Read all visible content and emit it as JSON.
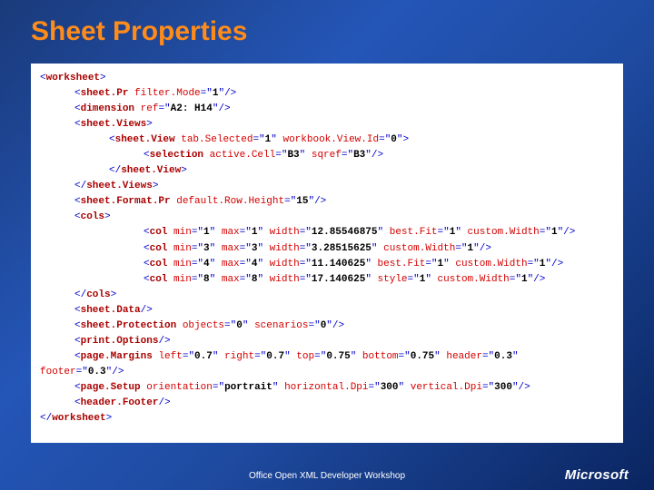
{
  "title": "Sheet Properties",
  "footer": "Office Open XML Developer Workshop",
  "logo": "Microsoft",
  "code": [
    {
      "indent": 0,
      "parts": [
        [
          "p",
          "<"
        ],
        [
          "t",
          "worksheet"
        ],
        [
          "p",
          ">"
        ]
      ]
    },
    {
      "indent": 1,
      "parts": [
        [
          "p",
          "<"
        ],
        [
          "t",
          "sheet.Pr "
        ],
        [
          "a",
          "filter.Mode"
        ],
        [
          "p",
          "=\""
        ],
        [
          "v",
          "1"
        ],
        [
          "p",
          "\"/>"
        ]
      ]
    },
    {
      "indent": 1,
      "parts": [
        [
          "p",
          "<"
        ],
        [
          "t",
          "dimension "
        ],
        [
          "a",
          "ref"
        ],
        [
          "p",
          "=\""
        ],
        [
          "v",
          "A2: H14"
        ],
        [
          "p",
          "\"/>"
        ]
      ]
    },
    {
      "indent": 1,
      "parts": [
        [
          "p",
          "<"
        ],
        [
          "t",
          "sheet.Views"
        ],
        [
          "p",
          ">"
        ]
      ]
    },
    {
      "indent": 2,
      "parts": [
        [
          "p",
          "<"
        ],
        [
          "t",
          "sheet.View "
        ],
        [
          "a",
          "tab.Selected"
        ],
        [
          "p",
          "=\""
        ],
        [
          "v",
          "1"
        ],
        [
          "p",
          "\" "
        ],
        [
          "a",
          "workbook.View.Id"
        ],
        [
          "p",
          "=\""
        ],
        [
          "v",
          "0"
        ],
        [
          "p",
          "\">"
        ]
      ]
    },
    {
      "indent": 3,
      "parts": [
        [
          "p",
          "<"
        ],
        [
          "t",
          "selection "
        ],
        [
          "a",
          "active.Cell"
        ],
        [
          "p",
          "=\""
        ],
        [
          "v",
          "B3"
        ],
        [
          "p",
          "\" "
        ],
        [
          "a",
          "sqref"
        ],
        [
          "p",
          "=\""
        ],
        [
          "v",
          "B3"
        ],
        [
          "p",
          "\"/>"
        ]
      ]
    },
    {
      "indent": 2,
      "parts": [
        [
          "p",
          "</"
        ],
        [
          "t",
          "sheet.View"
        ],
        [
          "p",
          ">"
        ]
      ]
    },
    {
      "indent": 1,
      "parts": [
        [
          "p",
          "</"
        ],
        [
          "t",
          "sheet.Views"
        ],
        [
          "p",
          ">"
        ]
      ]
    },
    {
      "indent": 1,
      "parts": [
        [
          "p",
          "<"
        ],
        [
          "t",
          "sheet.Format.Pr "
        ],
        [
          "a",
          "default.Row.Height"
        ],
        [
          "p",
          "=\""
        ],
        [
          "v",
          "15"
        ],
        [
          "p",
          "\"/>"
        ]
      ]
    },
    {
      "indent": 1,
      "parts": [
        [
          "p",
          "<"
        ],
        [
          "t",
          "cols"
        ],
        [
          "p",
          ">"
        ]
      ]
    },
    {
      "indent": 3,
      "parts": [
        [
          "p",
          "<"
        ],
        [
          "t",
          "col "
        ],
        [
          "a",
          "min"
        ],
        [
          "p",
          "=\""
        ],
        [
          "v",
          "1"
        ],
        [
          "p",
          "\" "
        ],
        [
          "a",
          "max"
        ],
        [
          "p",
          "=\""
        ],
        [
          "v",
          "1"
        ],
        [
          "p",
          "\" "
        ],
        [
          "a",
          "width"
        ],
        [
          "p",
          "=\""
        ],
        [
          "v",
          "12.85546875"
        ],
        [
          "p",
          "\" "
        ],
        [
          "a",
          "best.Fit"
        ],
        [
          "p",
          "=\""
        ],
        [
          "v",
          "1"
        ],
        [
          "p",
          "\" "
        ],
        [
          "a",
          "custom.Width"
        ],
        [
          "p",
          "=\""
        ],
        [
          "v",
          "1"
        ],
        [
          "p",
          "\"/>"
        ]
      ]
    },
    {
      "indent": 3,
      "parts": [
        [
          "p",
          "<"
        ],
        [
          "t",
          "col "
        ],
        [
          "a",
          "min"
        ],
        [
          "p",
          "=\""
        ],
        [
          "v",
          "3"
        ],
        [
          "p",
          "\" "
        ],
        [
          "a",
          "max"
        ],
        [
          "p",
          "=\""
        ],
        [
          "v",
          "3"
        ],
        [
          "p",
          "\" "
        ],
        [
          "a",
          "width"
        ],
        [
          "p",
          "=\""
        ],
        [
          "v",
          "3.28515625"
        ],
        [
          "p",
          "\" "
        ],
        [
          "a",
          "custom.Width"
        ],
        [
          "p",
          "=\""
        ],
        [
          "v",
          "1"
        ],
        [
          "p",
          "\"/>"
        ]
      ]
    },
    {
      "indent": 3,
      "parts": [
        [
          "p",
          "<"
        ],
        [
          "t",
          "col "
        ],
        [
          "a",
          "min"
        ],
        [
          "p",
          "=\""
        ],
        [
          "v",
          "4"
        ],
        [
          "p",
          "\" "
        ],
        [
          "a",
          "max"
        ],
        [
          "p",
          "=\""
        ],
        [
          "v",
          "4"
        ],
        [
          "p",
          "\" "
        ],
        [
          "a",
          "width"
        ],
        [
          "p",
          "=\""
        ],
        [
          "v",
          "11.140625"
        ],
        [
          "p",
          "\" "
        ],
        [
          "a",
          "best.Fit"
        ],
        [
          "p",
          "=\""
        ],
        [
          "v",
          "1"
        ],
        [
          "p",
          "\" "
        ],
        [
          "a",
          "custom.Width"
        ],
        [
          "p",
          "=\""
        ],
        [
          "v",
          "1"
        ],
        [
          "p",
          "\"/>"
        ]
      ]
    },
    {
      "indent": 3,
      "parts": [
        [
          "p",
          "<"
        ],
        [
          "t",
          "col "
        ],
        [
          "a",
          "min"
        ],
        [
          "p",
          "=\""
        ],
        [
          "v",
          "8"
        ],
        [
          "p",
          "\" "
        ],
        [
          "a",
          "max"
        ],
        [
          "p",
          "=\""
        ],
        [
          "v",
          "8"
        ],
        [
          "p",
          "\" "
        ],
        [
          "a",
          "width"
        ],
        [
          "p",
          "=\""
        ],
        [
          "v",
          "17.140625"
        ],
        [
          "p",
          "\" "
        ],
        [
          "a",
          "style"
        ],
        [
          "p",
          "=\""
        ],
        [
          "v",
          "1"
        ],
        [
          "p",
          "\" "
        ],
        [
          "a",
          "custom.Width"
        ],
        [
          "p",
          "=\""
        ],
        [
          "v",
          "1"
        ],
        [
          "p",
          "\"/>"
        ]
      ]
    },
    {
      "indent": 1,
      "parts": [
        [
          "p",
          "</"
        ],
        [
          "t",
          "cols"
        ],
        [
          "p",
          ">"
        ]
      ]
    },
    {
      "indent": 1,
      "parts": [
        [
          "p",
          "<"
        ],
        [
          "t",
          "sheet.Data"
        ],
        [
          "p",
          "/>"
        ]
      ]
    },
    {
      "indent": 1,
      "parts": [
        [
          "p",
          "<"
        ],
        [
          "t",
          "sheet.Protection "
        ],
        [
          "a",
          "objects"
        ],
        [
          "p",
          "=\""
        ],
        [
          "v",
          "0"
        ],
        [
          "p",
          "\" "
        ],
        [
          "a",
          "scenarios"
        ],
        [
          "p",
          "=\""
        ],
        [
          "v",
          "0"
        ],
        [
          "p",
          "\"/>"
        ]
      ]
    },
    {
      "indent": 1,
      "parts": [
        [
          "p",
          "<"
        ],
        [
          "t",
          "print.Options"
        ],
        [
          "p",
          "/>"
        ]
      ]
    },
    {
      "indent": 1,
      "wrap": 0,
      "parts": [
        [
          "p",
          "<"
        ],
        [
          "t",
          "page.Margins "
        ],
        [
          "a",
          "left"
        ],
        [
          "p",
          "=\""
        ],
        [
          "v",
          "0.7"
        ],
        [
          "p",
          "\" "
        ],
        [
          "a",
          "right"
        ],
        [
          "p",
          "=\""
        ],
        [
          "v",
          "0.7"
        ],
        [
          "p",
          "\" "
        ],
        [
          "a",
          "top"
        ],
        [
          "p",
          "=\""
        ],
        [
          "v",
          "0.75"
        ],
        [
          "p",
          "\" "
        ],
        [
          "a",
          "bottom"
        ],
        [
          "p",
          "=\""
        ],
        [
          "v",
          "0.75"
        ],
        [
          "p",
          "\" "
        ],
        [
          "a",
          "header"
        ],
        [
          "p",
          "=\""
        ],
        [
          "v",
          "0.3"
        ],
        [
          "p",
          "\" "
        ]
      ]
    },
    {
      "indent": 0,
      "parts": [
        [
          "a",
          "footer"
        ],
        [
          "p",
          "=\""
        ],
        [
          "v",
          "0.3"
        ],
        [
          "p",
          "\"/>"
        ]
      ]
    },
    {
      "indent": 1,
      "parts": [
        [
          "p",
          "<"
        ],
        [
          "t",
          "page.Setup "
        ],
        [
          "a",
          "orientation"
        ],
        [
          "p",
          "=\""
        ],
        [
          "v",
          "portrait"
        ],
        [
          "p",
          "\" "
        ],
        [
          "a",
          "horizontal.Dpi"
        ],
        [
          "p",
          "=\""
        ],
        [
          "v",
          "300"
        ],
        [
          "p",
          "\" "
        ],
        [
          "a",
          "vertical.Dpi"
        ],
        [
          "p",
          "=\""
        ],
        [
          "v",
          "300"
        ],
        [
          "p",
          "\"/>"
        ]
      ]
    },
    {
      "indent": 1,
      "parts": [
        [
          "p",
          "<"
        ],
        [
          "t",
          "header.Footer"
        ],
        [
          "p",
          "/>"
        ]
      ]
    },
    {
      "indent": 0,
      "parts": [
        [
          "p",
          "</"
        ],
        [
          "t",
          "worksheet"
        ],
        [
          "p",
          ">"
        ]
      ]
    }
  ]
}
